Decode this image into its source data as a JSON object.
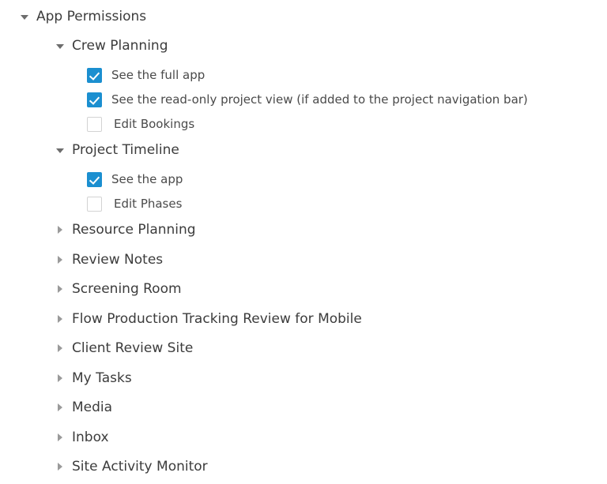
{
  "tree": {
    "root": {
      "label": "App Permissions",
      "twisty": "caret-down-icon",
      "expanded": true
    },
    "groups": [
      {
        "label": "Crew Planning",
        "twisty": "caret-down-icon",
        "expanded": true,
        "permissions": [
          {
            "label": "See the full app",
            "checked": true
          },
          {
            "label": "See the read-only project view (if added to the project navigation bar)",
            "checked": true
          },
          {
            "label": "Edit Bookings",
            "checked": false
          }
        ]
      },
      {
        "label": "Project Timeline",
        "twisty": "caret-down-icon",
        "expanded": true,
        "permissions": [
          {
            "label": "See the app",
            "checked": true
          },
          {
            "label": "Edit Phases",
            "checked": false
          }
        ]
      }
    ],
    "collapsed_groups": [
      {
        "label": "Resource Planning",
        "twisty": "caret-right-icon",
        "expanded": false
      },
      {
        "label": "Review Notes",
        "twisty": "caret-right-icon",
        "expanded": false
      },
      {
        "label": "Screening Room",
        "twisty": "caret-right-icon",
        "expanded": false
      },
      {
        "label": "Flow Production Tracking Review for Mobile",
        "twisty": "caret-right-icon",
        "expanded": false
      },
      {
        "label": "Client Review Site",
        "twisty": "caret-right-icon",
        "expanded": false
      },
      {
        "label": "My Tasks",
        "twisty": "caret-right-icon",
        "expanded": false
      },
      {
        "label": "Media",
        "twisty": "caret-right-icon",
        "expanded": false
      },
      {
        "label": "Inbox",
        "twisty": "caret-right-icon",
        "expanded": false
      },
      {
        "label": "Site Activity Monitor",
        "twisty": "caret-right-icon",
        "expanded": false
      }
    ]
  },
  "colors": {
    "checkbox_checked": "#1b8fd0",
    "checkbox_border": "#d3d3d3",
    "text": "#3c3c3c",
    "twisty_expanded": "#6d6d6d",
    "twisty_collapsed": "#9a9a9a",
    "background": "#ffffff"
  }
}
